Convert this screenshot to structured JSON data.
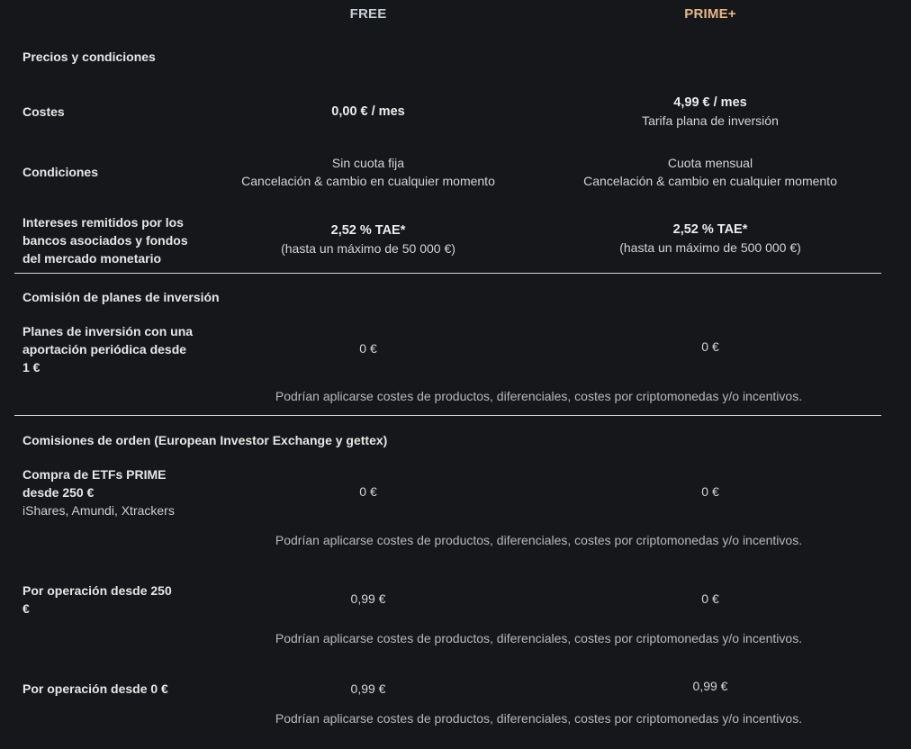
{
  "plans": {
    "free": "FREE",
    "prime": "PRIME+"
  },
  "colors": {
    "background": "#16171a",
    "prime_accent": "#e7b887",
    "free_header": "#c9cfd6",
    "divider": "#d6d6d6"
  },
  "sections": {
    "pricing": {
      "title": "Precios y condiciones",
      "costs": {
        "label": "Costes",
        "free": "0,00 € / mes",
        "prime": "4,99 € / mes",
        "prime_sub": "Tarifa plana de inversión"
      },
      "conditions": {
        "label": "Condiciones",
        "free_line1": "Sin cuota fija",
        "free_line2": "Cancelación & cambio en cualquier momento",
        "prime_line1": "Cuota mensual",
        "prime_line2": "Cancelación & cambio en cualquier momento"
      },
      "interest": {
        "label": "Intereses remitidos por los bancos asociados y fondos del mercado monetario",
        "free": "2,52 % TAE*",
        "free_sub": "(hasta un máximo de 50 000 €)",
        "prime": "2,52 % TAE*",
        "prime_sub": "(hasta un máximo de 500 000 €)"
      }
    },
    "plans_fee": {
      "title": "Comisión de planes de inversión",
      "savings_plans": {
        "label": "Planes de inversión con una aportación periódica desde 1 €",
        "free": "0 €",
        "prime": "0 €",
        "note": "Podrían aplicarse costes de productos, diferenciales, costes por criptomonedas y/o incentivos."
      }
    },
    "order_fees": {
      "title": "Comisiones de orden (European Investor Exchange y gettex)",
      "etf_prime": {
        "label": "Compra de ETFs PRIME desde 250 €",
        "sub": "iShares, Amundi, Xtrackers",
        "free": "0 €",
        "prime": "0 €",
        "note": "Podrían aplicarse costes de productos, diferenciales, costes por criptomonedas y/o incentivos."
      },
      "per_trade_250": {
        "label": "Por operación desde 250 €",
        "free": "0,99 €",
        "prime": "0 €",
        "note": "Podrían aplicarse costes de productos, diferenciales, costes por criptomonedas y/o incentivos."
      },
      "per_trade_0": {
        "label": "Por operación desde 0 €",
        "free": "0,99 €",
        "prime": "0,99 €",
        "note": "Podrían aplicarse costes de productos, diferenciales, costes por criptomonedas y/o incentivos."
      }
    }
  }
}
